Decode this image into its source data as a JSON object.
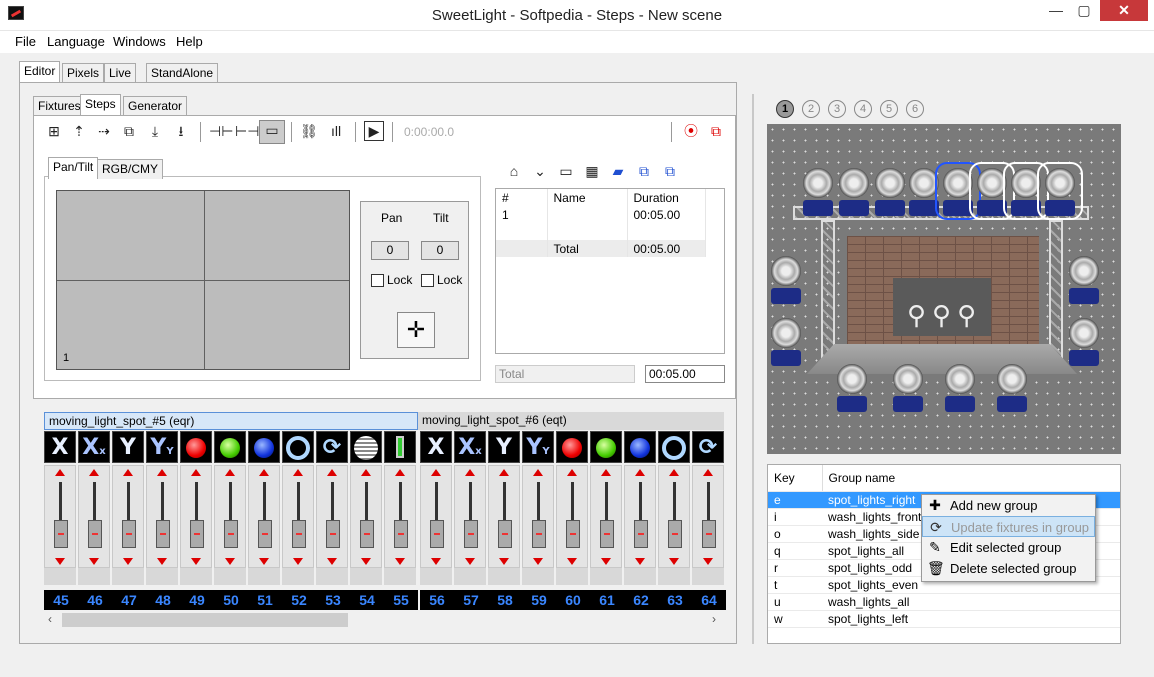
{
  "window": {
    "title": "SweetLight - Softpedia - Steps - New scene",
    "minimize": "—",
    "maximize": "▢",
    "close": "✕"
  },
  "menu": [
    "File",
    "Language",
    "Windows",
    "Help"
  ],
  "main_tabs": [
    "Editor",
    "Pixels",
    "Live",
    "StandAlone"
  ],
  "sub_tabs": [
    "Fixtures",
    "Steps",
    "Generator"
  ],
  "toolbar": {
    "timecode": "0:00:00.0"
  },
  "pantilt": {
    "tabs": [
      "Pan/Tilt",
      "RGB/CMY"
    ],
    "corner_label": "1",
    "pan_label": "Pan",
    "tilt_label": "Tilt",
    "pan_value": "0",
    "tilt_value": "0",
    "lock1": "Lock",
    "lock2": "Lock"
  },
  "steps_table": {
    "headers": [
      "#",
      "Name",
      "Duration"
    ],
    "rows": [
      {
        "num": "1",
        "name": "",
        "duration": "00:05.00"
      }
    ],
    "total_label": "Total",
    "total_duration": "00:05.00"
  },
  "total_field": {
    "label": "Total",
    "value": "00:05.00"
  },
  "fixture_headers": [
    "moving_light_spot_#5 (eqr)",
    "moving_light_spot_#6 (eqt)"
  ],
  "channels": [
    {
      "num": "45",
      "icon": "X"
    },
    {
      "num": "46",
      "icon": "Xx"
    },
    {
      "num": "47",
      "icon": "Y"
    },
    {
      "num": "48",
      "icon": "Yy"
    },
    {
      "num": "49",
      "icon": "red"
    },
    {
      "num": "50",
      "icon": "green"
    },
    {
      "num": "51",
      "icon": "blue"
    },
    {
      "num": "52",
      "icon": "ring"
    },
    {
      "num": "53",
      "icon": "rotate"
    },
    {
      "num": "54",
      "icon": "gobo"
    },
    {
      "num": "55",
      "icon": "battery"
    },
    {
      "num": "56",
      "icon": "X"
    },
    {
      "num": "57",
      "icon": "Xx"
    },
    {
      "num": "58",
      "icon": "Y"
    },
    {
      "num": "59",
      "icon": "Yy"
    },
    {
      "num": "60",
      "icon": "red"
    },
    {
      "num": "61",
      "icon": "green"
    },
    {
      "num": "62",
      "icon": "blue"
    },
    {
      "num": "63",
      "icon": "ring"
    },
    {
      "num": "64",
      "icon": "rotate"
    }
  ],
  "scene_numbers": [
    "1",
    "2",
    "3",
    "4",
    "5",
    "6"
  ],
  "groups": {
    "headers": [
      "Key",
      "Group name"
    ],
    "rows": [
      {
        "key": "e",
        "name": "spot_lights_right"
      },
      {
        "key": "i",
        "name": "wash_lights_front"
      },
      {
        "key": "o",
        "name": "wash_lights_side"
      },
      {
        "key": "q",
        "name": "spot_lights_all"
      },
      {
        "key": "r",
        "name": "spot_lights_odd"
      },
      {
        "key": "t",
        "name": "spot_lights_even"
      },
      {
        "key": "u",
        "name": "wash_lights_all"
      },
      {
        "key": "w",
        "name": "spot_lights_left"
      }
    ]
  },
  "context_menu": [
    "Add new group",
    "Update fixtures in group",
    "Edit selected group",
    "Delete selected group"
  ],
  "colors": {
    "accent": "#3399ff",
    "close": "#c7383a",
    "channel_num": "#3a86ff",
    "fixture_base": "#1d2c86"
  }
}
